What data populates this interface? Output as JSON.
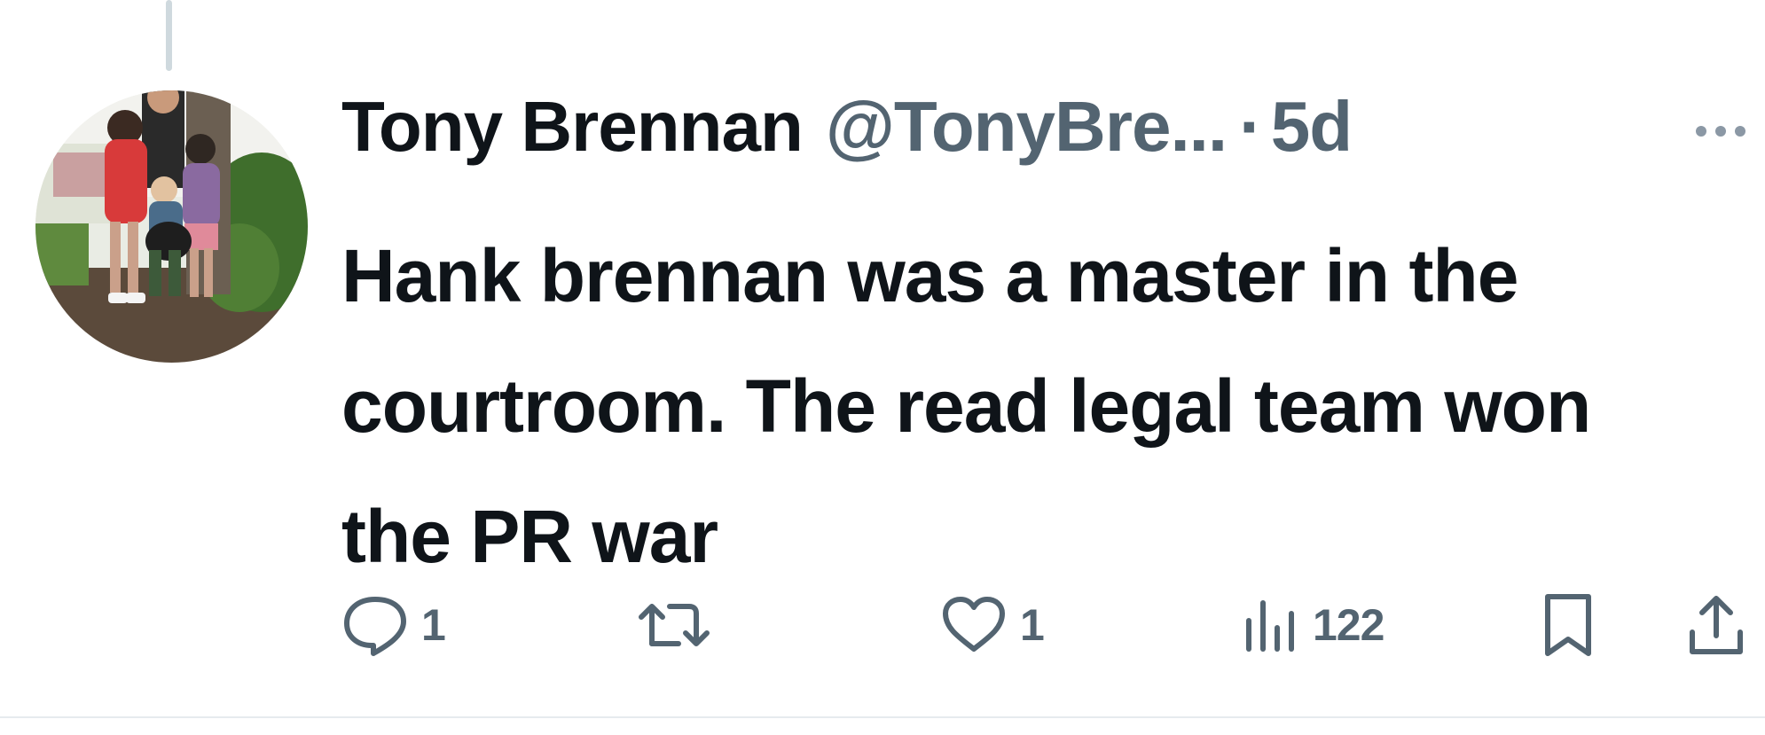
{
  "tweet": {
    "display_name": "Tony Brennan",
    "handle": "@TonyBre...",
    "separator": "·",
    "time": "5d",
    "text": "Hank brennan was a master in the courtroom. The read legal team won the PR war"
  },
  "actions": {
    "reply_count": "1",
    "retweet_count": "",
    "like_count": "1",
    "views_count": "122"
  },
  "icons": {
    "reply": "reply-bubble-icon",
    "retweet": "retweet-icon",
    "like": "heart-icon",
    "views": "views-bar-chart-icon",
    "bookmark": "bookmark-icon",
    "share": "share-upload-icon",
    "more": "more-dots-icon"
  },
  "colors": {
    "text": "#0f1419",
    "secondary": "#536471",
    "divider": "#e6ebee",
    "thread_line": "#cfd9de"
  }
}
